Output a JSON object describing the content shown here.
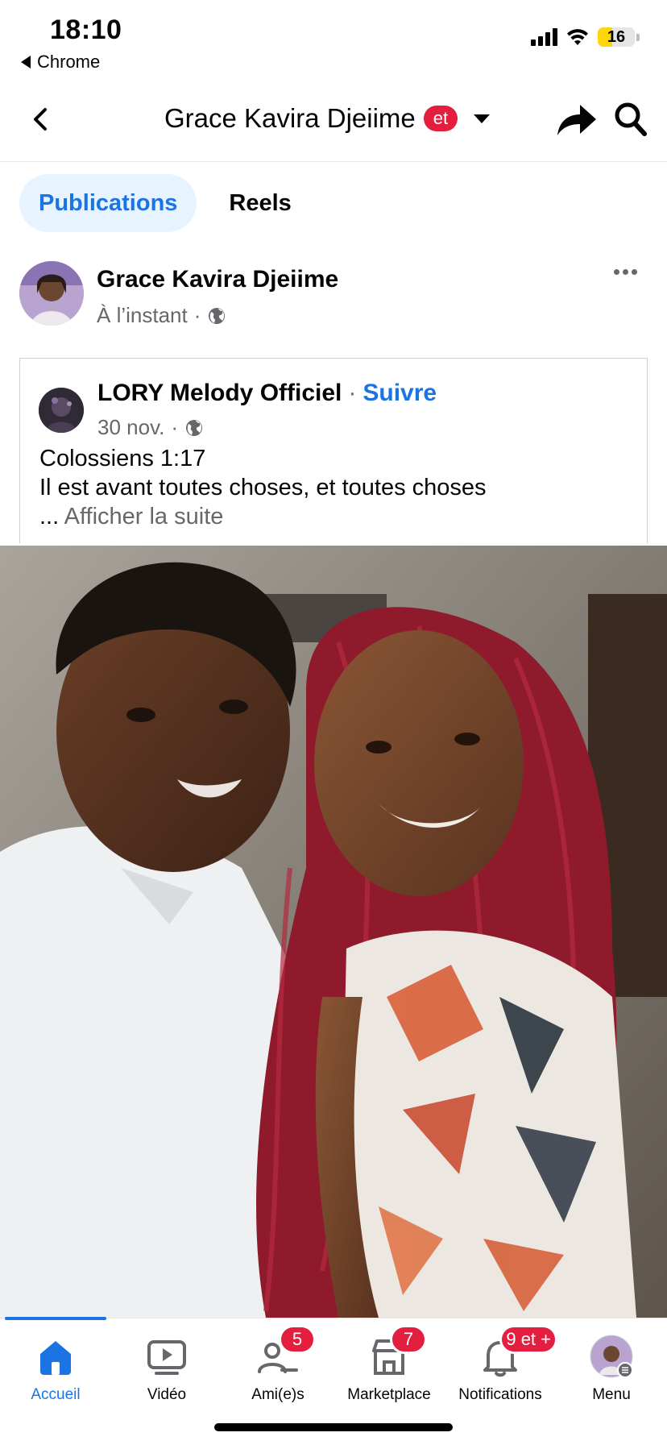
{
  "status_bar": {
    "time": "18:10",
    "back_app": "Chrome",
    "battery_level": "16",
    "icons": [
      "back-triangle-icon",
      "cellular-signal-icon",
      "wifi-icon",
      "battery-icon"
    ]
  },
  "header": {
    "title": "Grace Kavira Djeiime",
    "badge": "et",
    "icons": [
      "back-arrow-icon",
      "chevron-down-icon",
      "share-arrow-icon",
      "search-icon"
    ]
  },
  "tabs": [
    {
      "label": "Publications",
      "active": true
    },
    {
      "label": "Reels",
      "active": false
    }
  ],
  "post": {
    "author": "Grace Kavira Djeiime",
    "time": "À l’instant",
    "separator": "·",
    "privacy_icon": "globe-icon",
    "shared": {
      "author": "LORY Melody Officiel",
      "separator": "·",
      "follow_label": "Suivre",
      "date": "30 nov.",
      "text_line1": "Colossiens 1:17",
      "text_line2": "Il est avant toutes choses, et toutes choses",
      "ellipsis": "...",
      "see_more": "Afficher la suite"
    }
  },
  "bottom_nav": [
    {
      "label": "Accueil",
      "icon": "home-icon",
      "badge": "",
      "active": true
    },
    {
      "label": "Vidéo",
      "icon": "video-icon",
      "badge": "",
      "active": false
    },
    {
      "label": "Ami(e)s",
      "icon": "friends-icon",
      "badge": "5",
      "active": false
    },
    {
      "label": "Marketplace",
      "icon": "marketplace-icon",
      "badge": "7",
      "active": false
    },
    {
      "label": "Notifications",
      "icon": "bell-icon",
      "badge": "9 et +",
      "active": false
    },
    {
      "label": "Menu",
      "icon": "profile-avatar",
      "badge": "",
      "active": false
    }
  ],
  "colors": {
    "accent": "#1b74e4",
    "tab_active_bg": "#e7f3ff",
    "badge_red": "#e41e3f",
    "secondary_text": "#65676b"
  }
}
